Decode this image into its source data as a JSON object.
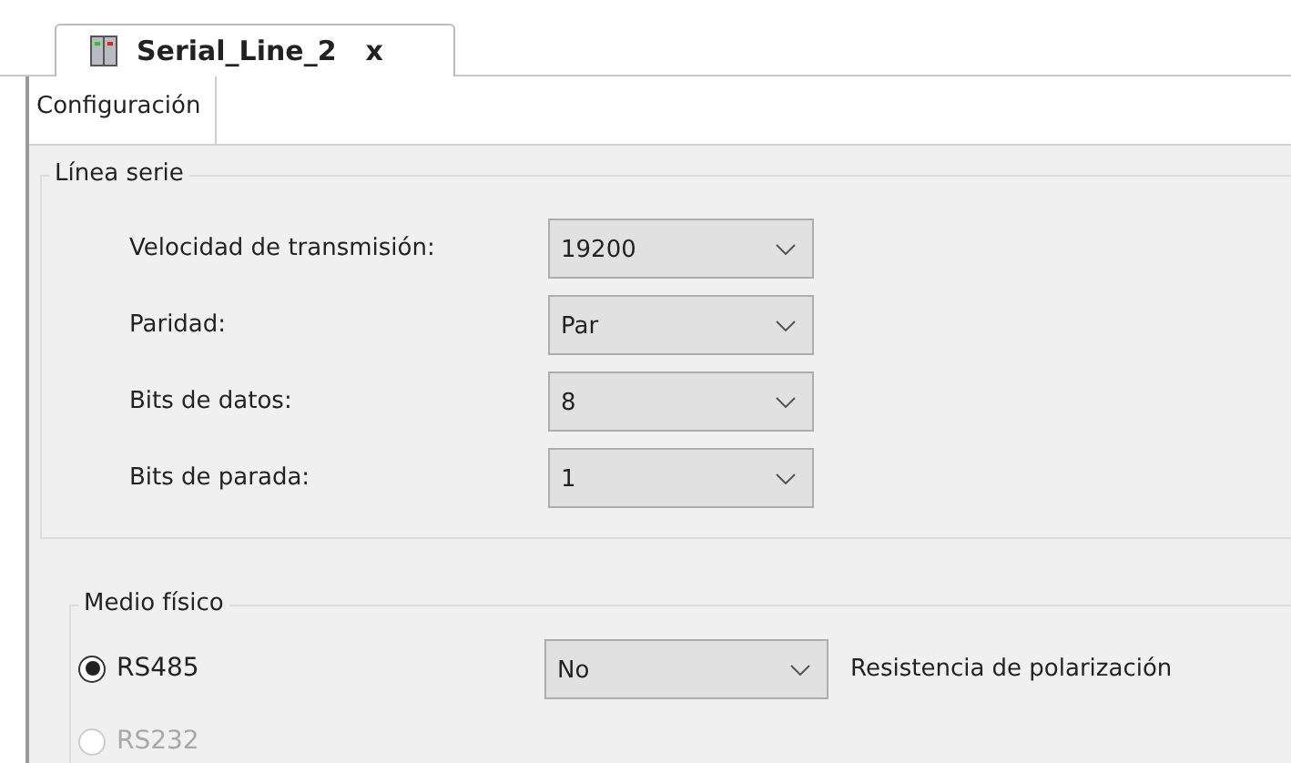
{
  "editor_tab": {
    "title": "Serial_Line_2",
    "close": "x",
    "selected": true
  },
  "subtabs": [
    {
      "label": "Configuración",
      "selected": true
    }
  ],
  "serial_line": {
    "legend": "Línea serie",
    "fields": [
      {
        "label": "Velocidad de transmisión:",
        "value": "19200"
      },
      {
        "label": "Paridad:",
        "value": "Par"
      },
      {
        "label": "Bits de datos:",
        "value": "8"
      },
      {
        "label": "Bits de parada:",
        "value": "1"
      }
    ]
  },
  "physical_medium": {
    "legend": "Medio físico",
    "options": [
      {
        "label": "RS485",
        "selected": true,
        "disabled": false,
        "dropdown": {
          "value": "No",
          "label": "Resistencia de polarización"
        }
      },
      {
        "label": "RS232",
        "selected": false,
        "disabled": true
      }
    ]
  }
}
